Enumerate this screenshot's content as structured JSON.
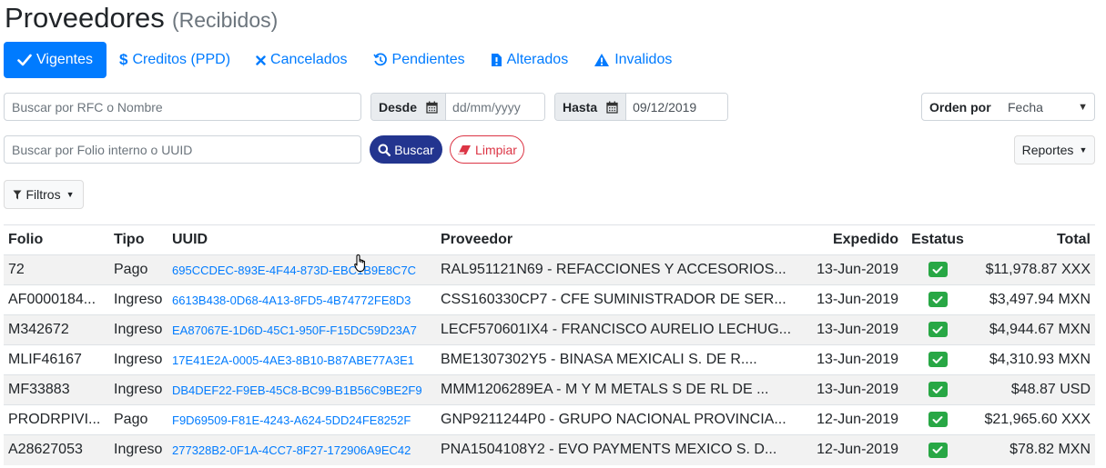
{
  "header": {
    "title": "Proveedores",
    "subtitle": "(Recibidos)"
  },
  "tabs": [
    {
      "label": "Vigentes",
      "icon": "check-icon",
      "active": true
    },
    {
      "label": "Creditos (PPD)",
      "icon": "dollar-icon"
    },
    {
      "label": "Cancelados",
      "icon": "times-icon"
    },
    {
      "label": "Pendientes",
      "icon": "history-icon"
    },
    {
      "label": "Alterados",
      "icon": "file-alert-icon"
    },
    {
      "label": "Invalidos",
      "icon": "warning-icon"
    }
  ],
  "filters": {
    "search_rfc_placeholder": "Buscar por RFC o Nombre",
    "desde_label": "Desde",
    "desde_placeholder": "dd/mm/yyyy",
    "hasta_label": "Hasta",
    "hasta_value": "09/12/2019",
    "orden_label": "Orden por",
    "orden_value": "Fecha",
    "search_folio_placeholder": "Buscar por Folio interno o UUID",
    "buscar_label": "Buscar",
    "limpiar_label": "Limpiar",
    "reportes_label": "Reportes",
    "filtros_label": "Filtros"
  },
  "table": {
    "headers": {
      "folio": "Folio",
      "tipo": "Tipo",
      "uuid": "UUID",
      "proveedor": "Proveedor",
      "expedido": "Expedido",
      "estatus": "Estatus",
      "total": "Total"
    },
    "rows": [
      {
        "folio": "72",
        "tipo": "Pago",
        "uuid": "695CCDEC-893E-4F44-873D-EBC1B9E8C7C",
        "proveedor": "RAL951121N69 - REFACCIONES Y ACCESORIOS...",
        "expedido": "13-Jun-2019",
        "total": "$11,978.87 XXX"
      },
      {
        "folio": "AF0000184...",
        "tipo": "Ingreso",
        "uuid": "6613B438-0D68-4A13-8FD5-4B74772FE8D3",
        "proveedor": "CSS160330CP7 - CFE SUMINISTRADOR DE SER...",
        "expedido": "13-Jun-2019",
        "total": "$3,497.94 MXN"
      },
      {
        "folio": "M342672",
        "tipo": "Ingreso",
        "uuid": "EA87067E-1D6D-45C1-950F-F15DC59D23A7",
        "proveedor": "LECF570601IX4 - FRANCISCO AURELIO LECHUG...",
        "expedido": "13-Jun-2019",
        "total": "$4,944.67 MXN"
      },
      {
        "folio": "MLIF46167",
        "tipo": "Ingreso",
        "uuid": "17E41E2A-0005-4AE3-8B10-B87ABE77A3E1",
        "proveedor": "BME1307302Y5 - BINASA MEXICALI S. DE R....",
        "expedido": "13-Jun-2019",
        "total": "$4,310.93 MXN"
      },
      {
        "folio": "MF33883",
        "tipo": "Ingreso",
        "uuid": "DB4DEF22-F9EB-45C8-BC99-B1B56C9BE2F9",
        "proveedor": "MMM1206289EA - M Y M METALS S DE RL DE ...",
        "expedido": "13-Jun-2019",
        "total": "$48.87 USD"
      },
      {
        "folio": "PRODRPIVI...",
        "tipo": "Pago",
        "uuid": "F9D69509-F81E-4243-A624-5DD24FE8252F",
        "proveedor": "GNP9211244P0 - GRUPO NACIONAL PROVINCIA...",
        "expedido": "12-Jun-2019",
        "total": "$21,965.60 XXX"
      },
      {
        "folio": "A28627053",
        "tipo": "Ingreso",
        "uuid": "277328B2-0F1A-4CC7-8F27-172906A9EC42",
        "proveedor": "PNA1504108Y2 - EVO PAYMENTS MEXICO S. D...",
        "expedido": "12-Jun-2019",
        "total": "$78.82 MXN"
      }
    ]
  },
  "colors": {
    "primary": "#007bff",
    "buscar": "#23358f",
    "danger": "#dc3545",
    "success": "#28a745"
  }
}
